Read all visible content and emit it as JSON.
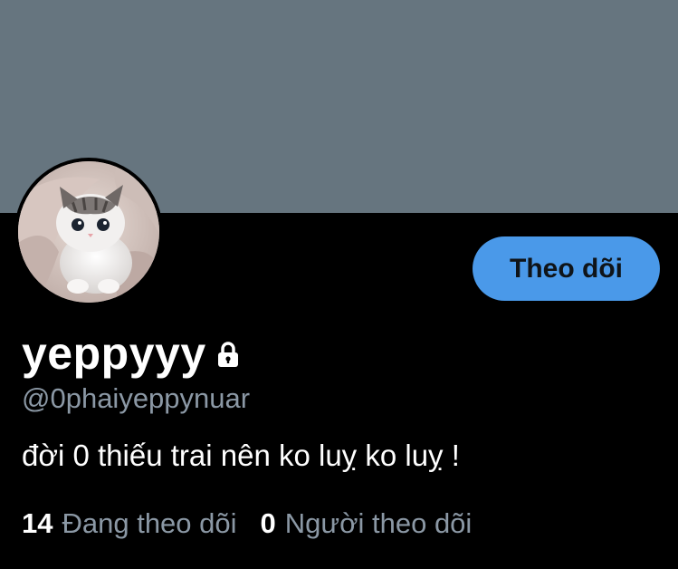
{
  "profile": {
    "display_name": "yeppyyy",
    "handle": "@0phaiyeppynuar",
    "bio": "đời 0 thiếu trai nên ko luỵ ko luỵ !",
    "protected": true,
    "avatar_description_icon": "cat-avatar"
  },
  "actions": {
    "follow_label": "Theo dõi"
  },
  "stats": {
    "following_count": "14",
    "following_label": "Đang theo dõi",
    "followers_count": "0",
    "followers_label": "Người theo dõi"
  },
  "colors": {
    "banner": "#66757f",
    "background": "#000000",
    "accent": "#4a99e9",
    "secondary_text": "#8b98a5"
  }
}
